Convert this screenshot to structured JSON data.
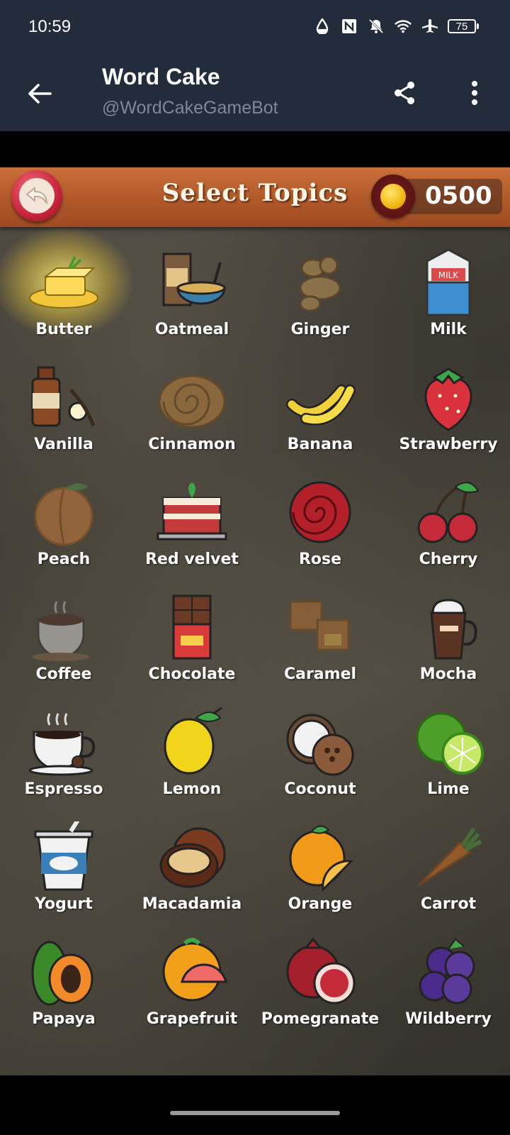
{
  "status": {
    "time": "10:59",
    "battery": "75"
  },
  "appbar": {
    "title": "Word Cake",
    "subtitle": "@WordCakeGameBot"
  },
  "game": {
    "title": "Select Topics",
    "coins": "0500"
  },
  "topics": [
    {
      "label": "Butter",
      "icon": "butter-icon",
      "selected": true
    },
    {
      "label": "Oatmeal",
      "icon": "oatmeal-icon"
    },
    {
      "label": "Ginger",
      "icon": "ginger-icon",
      "dim": true
    },
    {
      "label": "Milk",
      "icon": "milk-icon"
    },
    {
      "label": "Vanilla",
      "icon": "vanilla-icon"
    },
    {
      "label": "Cinnamon",
      "icon": "cinnamon-roll-icon",
      "dim": true
    },
    {
      "label": "Banana",
      "icon": "banana-icon"
    },
    {
      "label": "Strawberry",
      "icon": "strawberry-icon"
    },
    {
      "label": "Peach",
      "icon": "peach-icon",
      "dim": true
    },
    {
      "label": "Red velvet",
      "icon": "red-velvet-cake-icon"
    },
    {
      "label": "Rose",
      "icon": "rose-icon"
    },
    {
      "label": "Cherry",
      "icon": "cherry-icon"
    },
    {
      "label": "Coffee",
      "icon": "coffee-cup-icon",
      "dim": true
    },
    {
      "label": "Chocolate",
      "icon": "chocolate-bar-icon"
    },
    {
      "label": "Caramel",
      "icon": "caramel-icon",
      "dim": true
    },
    {
      "label": "Mocha",
      "icon": "mocha-icon"
    },
    {
      "label": "Espresso",
      "icon": "espresso-icon"
    },
    {
      "label": "Lemon",
      "icon": "lemon-icon"
    },
    {
      "label": "Coconut",
      "icon": "coconut-icon"
    },
    {
      "label": "Lime",
      "icon": "lime-icon"
    },
    {
      "label": "Yogurt",
      "icon": "yogurt-icon"
    },
    {
      "label": "Macadamia",
      "icon": "macadamia-icon"
    },
    {
      "label": "Orange",
      "icon": "orange-icon"
    },
    {
      "label": "Carrot",
      "icon": "carrot-icon",
      "dim": true
    },
    {
      "label": "Papaya",
      "icon": "papaya-icon"
    },
    {
      "label": "Grapefruit",
      "icon": "grapefruit-icon"
    },
    {
      "label": "Pomegranate",
      "icon": "pomegranate-icon"
    },
    {
      "label": "Wildberry",
      "icon": "wildberry-icon"
    }
  ]
}
